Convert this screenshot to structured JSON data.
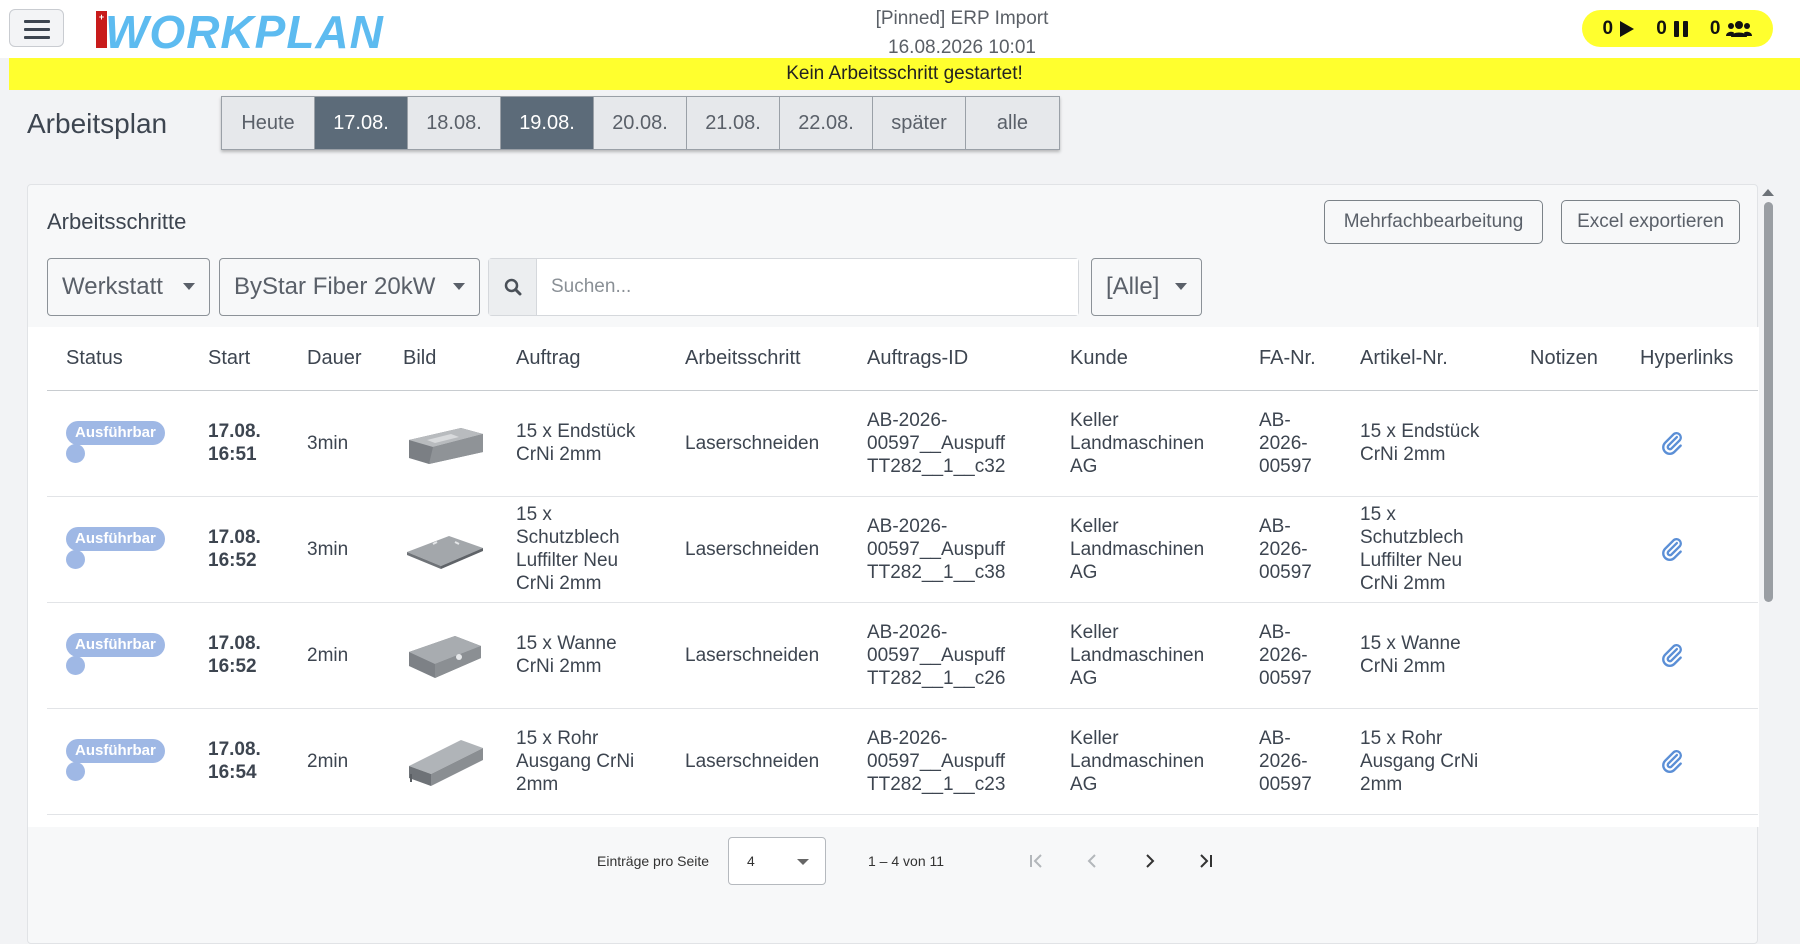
{
  "header": {
    "app_name": "WORKPLAN",
    "context_title": "[Pinned] ERP Import",
    "context_datetime": "16.08.2026 10:01",
    "status": {
      "running_count": "0",
      "paused_count": "0",
      "users_count": "0"
    },
    "banner": "Kein Arbeitsschritt gestartet!"
  },
  "page": {
    "title": "Arbeitsplan",
    "date_tabs": [
      {
        "label": "Heute",
        "active": false
      },
      {
        "label": "17.08.",
        "active": true
      },
      {
        "label": "18.08.",
        "active": false
      },
      {
        "label": "19.08.",
        "active": true
      },
      {
        "label": "20.08.",
        "active": false
      },
      {
        "label": "21.08.",
        "active": false
      },
      {
        "label": "22.08.",
        "active": false
      },
      {
        "label": "später",
        "active": false
      },
      {
        "label": "alle",
        "active": false
      }
    ]
  },
  "card": {
    "title": "Arbeitsschritte",
    "multi_edit_label": "Mehrfachbearbeitung",
    "export_label": "Excel exportieren",
    "filters": {
      "location": "Werkstatt",
      "machine": "ByStar Fiber 20kW",
      "search_placeholder": "Suchen...",
      "search_value": "",
      "status_filter": "[Alle]"
    }
  },
  "table": {
    "columns": [
      "Status",
      "Start",
      "Dauer",
      "Bild",
      "Auftrag",
      "Arbeitsschritt",
      "Auftrags-ID",
      "Kunde",
      "FA-Nr.",
      "Artikel-Nr.",
      "Notizen",
      "Hyperlinks"
    ],
    "rows": [
      {
        "status": "Ausführbar",
        "start_date": "17.08.",
        "start_time": "16:51",
        "duration": "3min",
        "image": "end-piece",
        "order_l1": "15 x Endstück",
        "order_l2": "CrNi 2mm",
        "order_l3": "",
        "order_l4": "",
        "step": "Laserschneiden",
        "order_id_l1": "AB-2026-",
        "order_id_l2": "00597__Auspuff",
        "order_id_l3": "TT282__1__c32",
        "customer_l1": "Keller",
        "customer_l2": "Landmaschinen",
        "customer_l3": "AG",
        "fa_l1": "AB-",
        "fa_l2": "2026-",
        "fa_l3": "00597",
        "article_l1": "15 x Endstück",
        "article_l2": "CrNi 2mm",
        "article_l3": "",
        "article_l4": "",
        "notes": ""
      },
      {
        "status": "Ausführbar",
        "start_date": "17.08.",
        "start_time": "16:52",
        "duration": "3min",
        "image": "protective-plate",
        "order_l1": "15 x",
        "order_l2": "Schutzblech",
        "order_l3": "Luffilter Neu",
        "order_l4": "CrNi 2mm",
        "step": "Laserschneiden",
        "order_id_l1": "AB-2026-",
        "order_id_l2": "00597__Auspuff",
        "order_id_l3": "TT282__1__c38",
        "customer_l1": "Keller",
        "customer_l2": "Landmaschinen",
        "customer_l3": "AG",
        "fa_l1": "AB-",
        "fa_l2": "2026-",
        "fa_l3": "00597",
        "article_l1": "15 x",
        "article_l2": "Schutzblech",
        "article_l3": "Luffilter Neu",
        "article_l4": "CrNi 2mm",
        "notes": ""
      },
      {
        "status": "Ausführbar",
        "start_date": "17.08.",
        "start_time": "16:52",
        "duration": "2min",
        "image": "tray",
        "order_l1": "15 x Wanne",
        "order_l2": "CrNi 2mm",
        "order_l3": "",
        "order_l4": "",
        "step": "Laserschneiden",
        "order_id_l1": "AB-2026-",
        "order_id_l2": "00597__Auspuff",
        "order_id_l3": "TT282__1__c26",
        "customer_l1": "Keller",
        "customer_l2": "Landmaschinen",
        "customer_l3": "AG",
        "fa_l1": "AB-",
        "fa_l2": "2026-",
        "fa_l3": "00597",
        "article_l1": "15 x Wanne",
        "article_l2": "CrNi 2mm",
        "article_l3": "",
        "article_l4": "",
        "notes": ""
      },
      {
        "status": "Ausführbar",
        "start_date": "17.08.",
        "start_time": "16:54",
        "duration": "2min",
        "image": "pipe-outlet",
        "order_l1": "15 x Rohr",
        "order_l2": "Ausgang CrNi",
        "order_l3": "2mm",
        "order_l4": "",
        "step": "Laserschneiden",
        "order_id_l1": "AB-2026-",
        "order_id_l2": "00597__Auspuff",
        "order_id_l3": "TT282__1__c23",
        "customer_l1": "Keller",
        "customer_l2": "Landmaschinen",
        "customer_l3": "AG",
        "fa_l1": "AB-",
        "fa_l2": "2026-",
        "fa_l3": "00597",
        "article_l1": "15 x Rohr",
        "article_l2": "Ausgang CrNi",
        "article_l3": "2mm",
        "article_l4": "",
        "notes": ""
      }
    ]
  },
  "pagination": {
    "per_page_label": "Einträge pro Seite",
    "per_page_value": "4",
    "range_text": "1 – 4 von 11"
  },
  "colors": {
    "accent_yellow": "#ffff2e",
    "logo_blue": "#5dbbf0",
    "active_tab": "#5c6b79",
    "badge": "#9fb8e5",
    "link_icon": "#5b8fd6"
  }
}
